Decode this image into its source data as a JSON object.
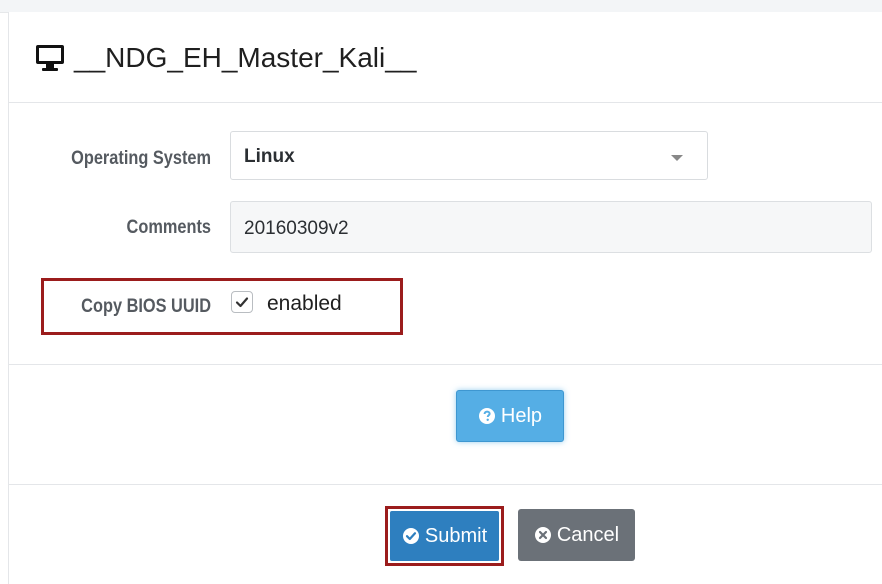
{
  "header": {
    "title": "__NDG_EH_Master_Kali__",
    "icon": "monitor-icon"
  },
  "form": {
    "os_label": "Operating System",
    "os_value": "Linux",
    "comments_label": "Comments",
    "comments_value": "20160309v2",
    "bios_label": "Copy BIOS UUID",
    "bios_checked": true,
    "bios_text": "enabled"
  },
  "buttons": {
    "help_label": "Help",
    "submit_label": "Submit",
    "cancel_label": "Cancel"
  },
  "colors": {
    "highlight": "#9b1c1c",
    "help": "#55aee5",
    "submit": "#2e7fbf",
    "cancel": "#6b7178"
  }
}
